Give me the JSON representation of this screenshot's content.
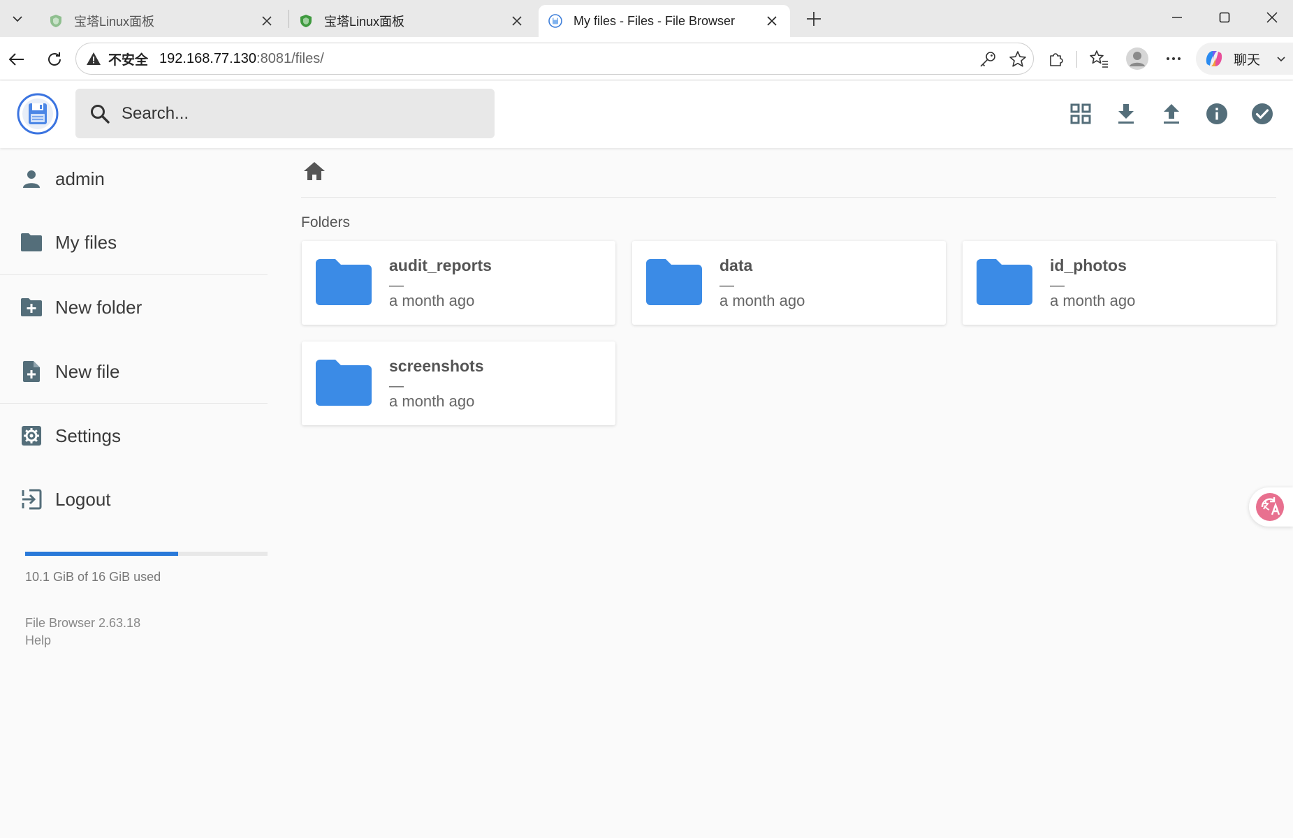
{
  "browser": {
    "tabs": [
      {
        "title": "宝塔Linux面板",
        "active": false
      },
      {
        "title": "宝塔Linux面板",
        "active": false
      },
      {
        "title": "My files - Files - File Browser",
        "active": true
      }
    ],
    "address": {
      "security_label": "不安全",
      "url_host": "192.168.77.130",
      "url_rest": ":8081/files/"
    },
    "copilot_label": "聊天"
  },
  "header": {
    "search_placeholder": "Search...",
    "actions": [
      "grid-view-icon",
      "download-icon",
      "upload-icon",
      "info-icon",
      "select-check-icon"
    ]
  },
  "sidebar": {
    "user": "admin",
    "my_files": "My files",
    "new_folder": "New folder",
    "new_file": "New file",
    "settings": "Settings",
    "logout": "Logout",
    "usage": {
      "text": "10.1 GiB of 16 GiB used",
      "used_fraction": 0.63
    },
    "version": "File Browser 2.63.18",
    "help": "Help"
  },
  "main": {
    "section_title": "Folders",
    "folders": [
      {
        "name": "audit_reports",
        "size": "—",
        "modified": "a month ago"
      },
      {
        "name": "data",
        "size": "—",
        "modified": "a month ago"
      },
      {
        "name": "id_photos",
        "size": "—",
        "modified": "a month ago"
      },
      {
        "name": "screenshots",
        "size": "—",
        "modified": "a month ago"
      }
    ]
  },
  "colors": {
    "accent": "#2979d9",
    "folder": "#3b8be6",
    "icon": "#546e7a"
  }
}
